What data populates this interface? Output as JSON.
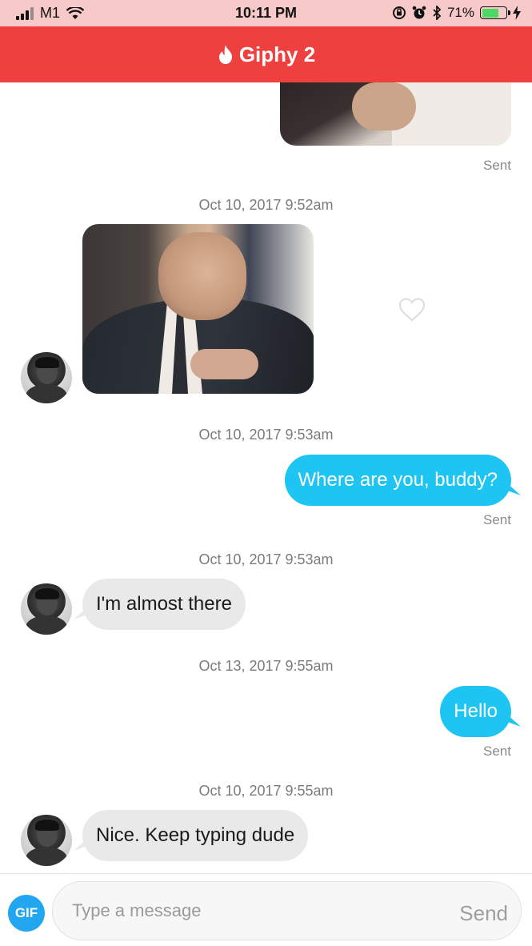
{
  "status_bar": {
    "carrier": "M1",
    "time": "10:11 PM",
    "battery_percent": "71%",
    "icons": [
      "signal-icon",
      "wifi-icon",
      "rotation-lock-icon",
      "alarm-icon",
      "bluetooth-icon",
      "battery-icon",
      "charging-icon"
    ]
  },
  "header": {
    "title": "Giphy 2",
    "icon": "tinder-flame-icon",
    "color": "#ef4040"
  },
  "messages": [
    {
      "type": "gif",
      "direction": "outgoing",
      "status": "Sent"
    },
    {
      "timestamp": "Oct 10, 2017 9:52am",
      "type": "gif",
      "direction": "incoming",
      "liked": false
    },
    {
      "timestamp": "Oct 10, 2017 9:53am",
      "type": "text",
      "direction": "outgoing",
      "text": "Where are you, buddy?",
      "status": "Sent"
    },
    {
      "timestamp": "Oct 10, 2017 9:53am",
      "type": "text",
      "direction": "incoming",
      "text": "I'm almost there"
    },
    {
      "timestamp": "Oct 13, 2017 9:55am",
      "type": "text",
      "direction": "outgoing",
      "text": "Hello",
      "status": "Sent"
    },
    {
      "timestamp": "Oct 10, 2017 9:55am",
      "type": "text",
      "direction": "incoming",
      "text": "Nice. Keep typing dude"
    }
  ],
  "composer": {
    "gif_label": "GIF",
    "placeholder": "Type a message",
    "value": "",
    "send_label": "Send"
  },
  "colors": {
    "outgoing_bubble": "#1ec5f3",
    "incoming_bubble": "#e9e9ea",
    "gif_button": "#21a6ef"
  }
}
